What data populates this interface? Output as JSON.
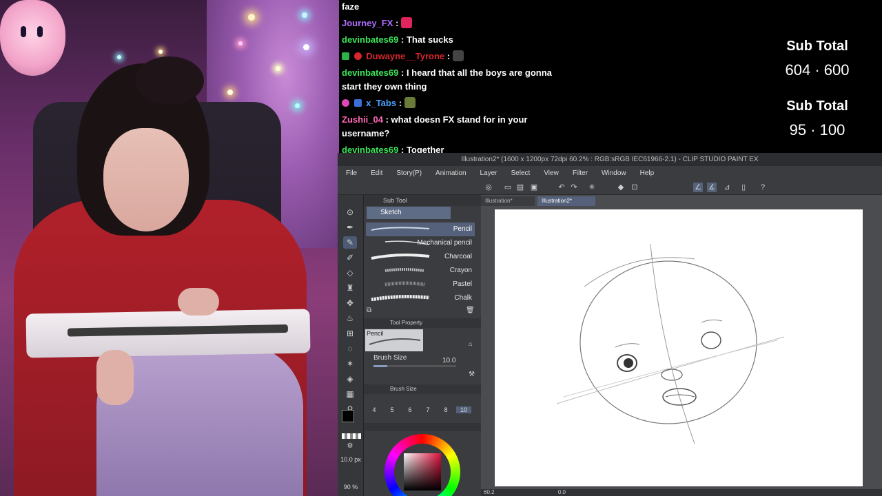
{
  "chat": {
    "messages": [
      {
        "user": "",
        "text": "faze",
        "color": "#ffffff"
      },
      {
        "user": "Journey_FX",
        "text": "",
        "color": "#b26cff",
        "emote": "#e0245e"
      },
      {
        "user": "devinbates69",
        "text": "That sucks",
        "color": "#3ee65b"
      },
      {
        "user": "Duwayne__Tyrone",
        "text": "",
        "color": "#d8262f",
        "emote": "#444444"
      },
      {
        "user": "devinbates69",
        "text": "I heard that all the boys are gonna start they own thing",
        "color": "#3ee65b"
      },
      {
        "user": "x_Tabs",
        "text": "",
        "color": "#4aa3ff",
        "emote": "#6a7b3a"
      },
      {
        "user": "Zushii_04",
        "text": "what doesn FX stand for in your username?",
        "color": "#ff69b4"
      },
      {
        "user": "devinbates69",
        "text": "Together",
        "color": "#3ee65b"
      }
    ]
  },
  "subs": {
    "label1": "Sub Total",
    "value1": "604 · 600",
    "label2": "Sub Total",
    "value2": "95 · 100"
  },
  "csp": {
    "title": "Illustration2* (1600 x 1200px 72dpi 60.2% : RGB:sRGB IEC61966-2.1) - CLIP STUDIO PAINT EX",
    "menu": [
      "File",
      "Edit",
      "Story(P)",
      "Animation",
      "Layer",
      "Select",
      "View",
      "Filter",
      "Window",
      "Help"
    ],
    "subtool_header": "Sub Tool",
    "group": "Sketch",
    "brushes": [
      "Pencil",
      "Mechanical pencil",
      "Charcoal",
      "Crayon",
      "Pastel",
      "Chalk"
    ],
    "tool_property_header": "Tool Property",
    "property_tool": "Pencil",
    "brush_size_label": "Brush Size",
    "brush_size_value": "10.0",
    "brush_size_header": "Brush Size",
    "brush_sizes": [
      "4",
      "5",
      "6",
      "7",
      "8",
      "10"
    ],
    "size_readout": "10.0 px",
    "opacity_readout": "90 %",
    "tabs": [
      "Illustration*",
      "Illustration2*"
    ],
    "zoom": "60.2",
    "angle": "0.0"
  }
}
